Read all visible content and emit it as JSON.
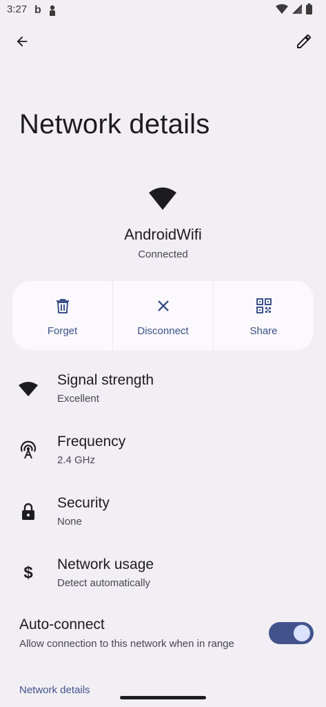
{
  "status_bar": {
    "time": "3:27",
    "icons": [
      "b-app-icon",
      "person-icon",
      "wifi-icon",
      "cell-signal-icon",
      "battery-icon"
    ]
  },
  "app_bar": {
    "back_icon": "arrow-back-icon",
    "edit_icon": "pencil-icon"
  },
  "page": {
    "title": "Network details"
  },
  "network": {
    "name": "AndroidWifi",
    "status": "Connected"
  },
  "actions": [
    {
      "label": "Forget",
      "icon": "trash-icon"
    },
    {
      "label": "Disconnect",
      "icon": "close-icon"
    },
    {
      "label": "Share",
      "icon": "qr-code-icon"
    }
  ],
  "details": [
    {
      "title": "Signal strength",
      "value": "Excellent",
      "icon": "wifi-icon"
    },
    {
      "title": "Frequency",
      "value": "2.4 GHz",
      "icon": "antenna-icon"
    },
    {
      "title": "Security",
      "value": "None",
      "icon": "lock-icon"
    },
    {
      "title": "Network usage",
      "value": "Detect automatically",
      "icon": "dollar-icon"
    }
  ],
  "auto_connect": {
    "title": "Auto-connect",
    "subtitle": "Allow connection to this network when in range",
    "enabled": true
  },
  "section_link": "Network details",
  "colors": {
    "background": "#f1eff4",
    "card": "#fbf9fd",
    "accent": "#42538c",
    "action_text": "#3c4f87"
  }
}
